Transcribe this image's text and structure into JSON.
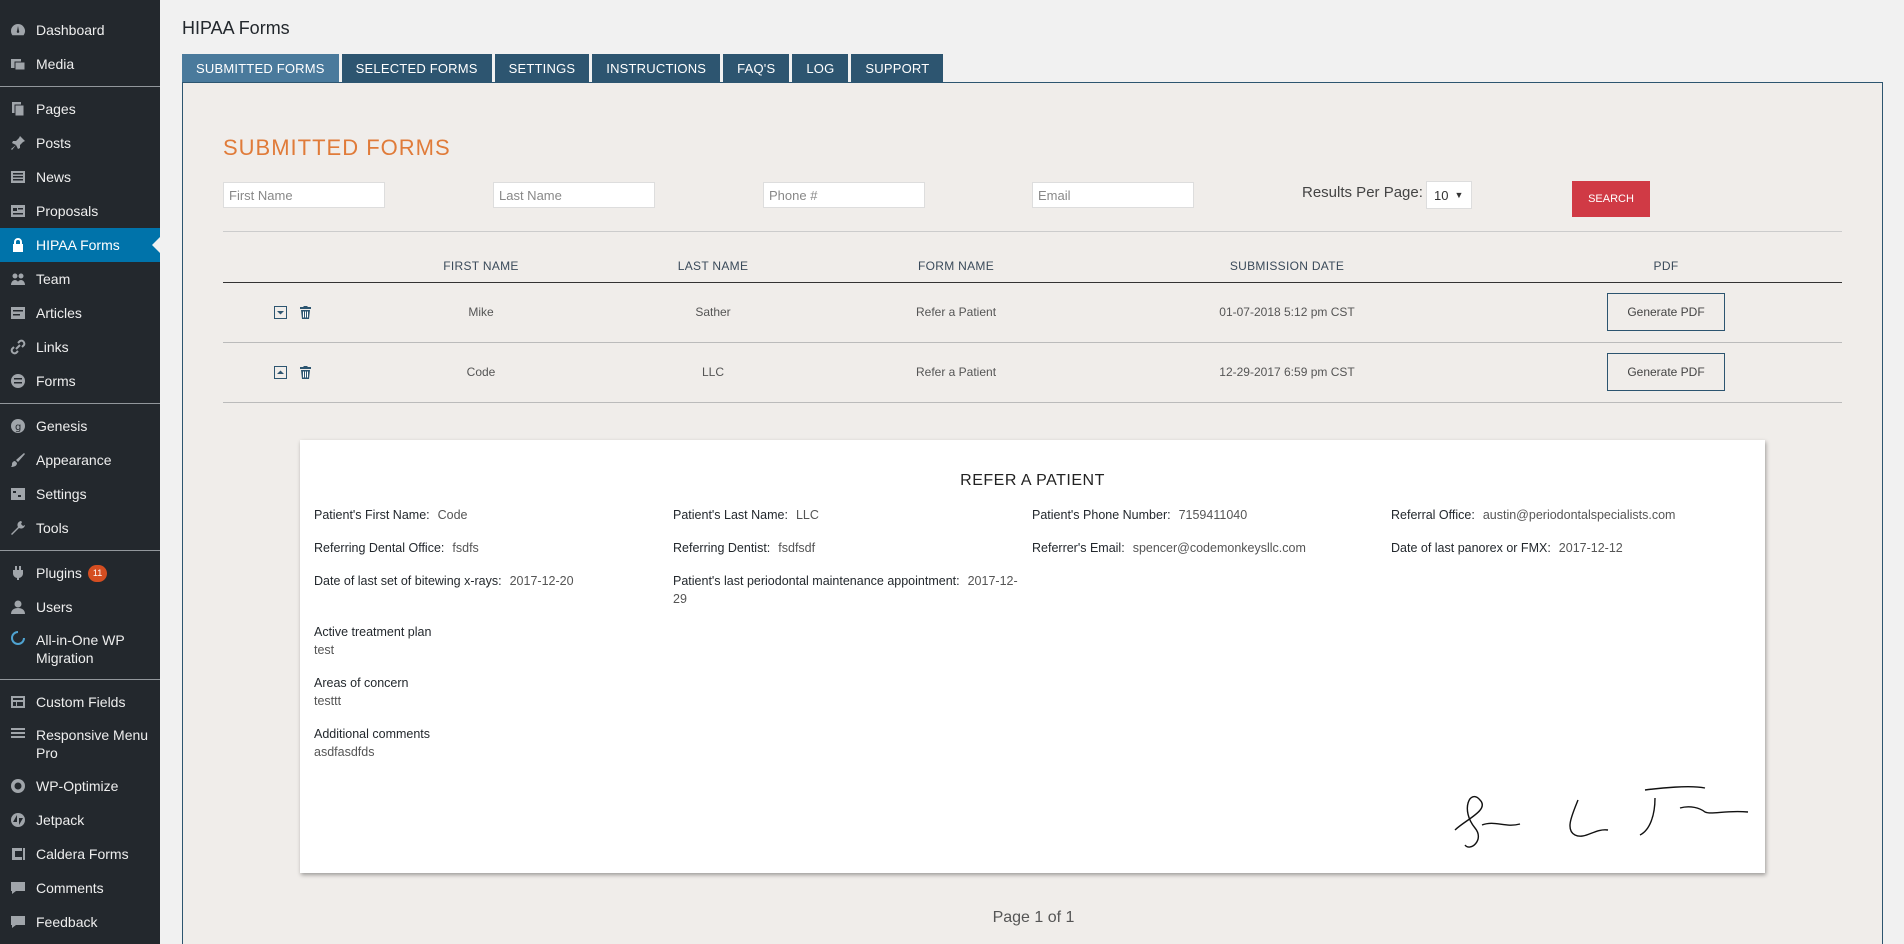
{
  "sidebar": {
    "items": [
      {
        "label": "Dashboard",
        "icon": "dashboard-icon"
      },
      {
        "label": "Media",
        "icon": "media-icon"
      },
      {
        "label": "Pages",
        "icon": "pages-icon"
      },
      {
        "label": "Posts",
        "icon": "pin-icon"
      },
      {
        "label": "News",
        "icon": "news-icon"
      },
      {
        "label": "Proposals",
        "icon": "proposals-icon"
      },
      {
        "label": "HIPAA Forms",
        "icon": "lock-icon"
      },
      {
        "label": "Team",
        "icon": "team-icon"
      },
      {
        "label": "Articles",
        "icon": "articles-icon"
      },
      {
        "label": "Links",
        "icon": "link-icon"
      },
      {
        "label": "Forms",
        "icon": "forms-icon"
      },
      {
        "label": "Genesis",
        "icon": "genesis-icon"
      },
      {
        "label": "Appearance",
        "icon": "brush-icon"
      },
      {
        "label": "Settings",
        "icon": "settings-icon"
      },
      {
        "label": "Tools",
        "icon": "wrench-icon"
      },
      {
        "label": "Plugins",
        "icon": "plugin-icon",
        "badge": "11"
      },
      {
        "label": "Users",
        "icon": "user-icon"
      },
      {
        "label": "All-in-One WP Migration",
        "icon": "migration-icon"
      },
      {
        "label": "Custom Fields",
        "icon": "custom-fields-icon"
      },
      {
        "label": "Responsive Menu Pro",
        "icon": "menu-icon"
      },
      {
        "label": "WP-Optimize",
        "icon": "optimize-icon"
      },
      {
        "label": "Jetpack",
        "icon": "jetpack-icon"
      },
      {
        "label": "Caldera Forms",
        "icon": "caldera-icon"
      },
      {
        "label": "Comments",
        "icon": "comment-icon"
      },
      {
        "label": "Feedback",
        "icon": "feedback-icon"
      }
    ]
  },
  "page": {
    "title": "HIPAA Forms",
    "tabs": [
      "SUBMITTED FORMS",
      "SELECTED FORMS",
      "SETTINGS",
      "INSTRUCTIONS",
      "FAQ'S",
      "LOG",
      "SUPPORT"
    ],
    "section_heading": "SUBMITTED FORMS"
  },
  "search": {
    "first_name_placeholder": "First Name",
    "last_name_placeholder": "Last Name",
    "phone_placeholder": "Phone #",
    "email_placeholder": "Email",
    "results_per_page_label": "Results Per Page:",
    "results_per_page_value": "10",
    "search_button": "SEARCH"
  },
  "table": {
    "headers": [
      "FIRST NAME",
      "LAST NAME",
      "FORM NAME",
      "SUBMISSION DATE",
      "PDF"
    ],
    "rows": [
      {
        "first": "Mike",
        "last": "Sather",
        "form": "Refer a Patient",
        "date": "01-07-2018 5:12 pm CST",
        "pdf": "Generate PDF",
        "expanded": false
      },
      {
        "first": "Code",
        "last": "LLC",
        "form": "Refer a Patient",
        "date": "12-29-2017 6:59 pm CST",
        "pdf": "Generate PDF",
        "expanded": true
      }
    ]
  },
  "form_detail": {
    "title": "REFER A PATIENT",
    "fields": {
      "first_name": {
        "label": "Patient's First Name:",
        "value": "Code"
      },
      "last_name": {
        "label": "Patient's Last Name:",
        "value": "LLC"
      },
      "phone": {
        "label": "Patient's Phone Number:",
        "value": "7159411040"
      },
      "referral_office": {
        "label": "Referral Office:",
        "value": "austin@periodontalspecialists.com"
      },
      "dental_office": {
        "label": "Referring Dental Office:",
        "value": "fsdfs"
      },
      "dentist": {
        "label": "Referring Dentist:",
        "value": "fsdfsdf"
      },
      "referrer_email": {
        "label": "Referrer's Email:",
        "value": "spencer@codemonkeysllc.com"
      },
      "panorex": {
        "label": "Date of last panorex or FMX:",
        "value": "2017-12-12"
      },
      "bitewing": {
        "label": "Date of last set of bitewing x-rays:",
        "value": "2017-12-20"
      },
      "perio": {
        "label": "Patient's last periodontal maintenance appointment:",
        "value": "2017-12-29"
      }
    },
    "blocks": {
      "treatment": {
        "label": "Active treatment plan",
        "value": "test"
      },
      "concern": {
        "label": "Areas of concern",
        "value": "testtt"
      },
      "comments": {
        "label": "Additional comments",
        "value": "asdfasdfds"
      }
    }
  },
  "pagination": {
    "text": "Page 1 of 1"
  }
}
